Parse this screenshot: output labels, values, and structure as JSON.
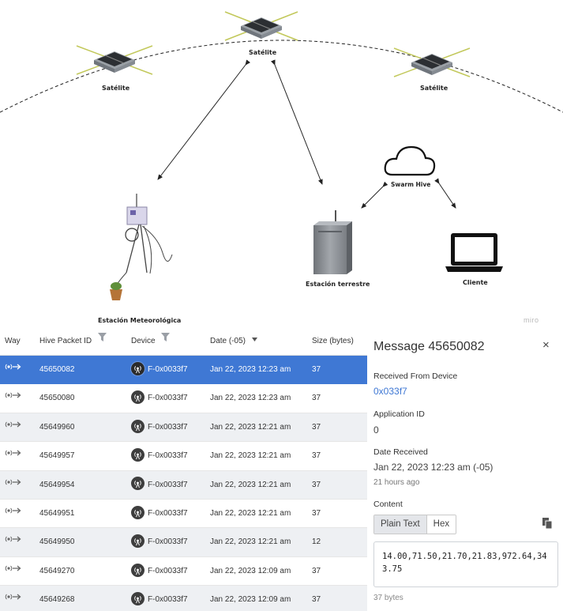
{
  "diagram": {
    "satellites": [
      "Satélite",
      "Satélite",
      "Satélite"
    ],
    "weather_station": "Estación Meteorológica",
    "ground_station": "Estación terrestre",
    "swarm_hive": "Swarm Hive",
    "client": "Cliente",
    "watermark": "miro"
  },
  "table": {
    "headers": {
      "way": "Way",
      "packet_id": "Hive Packet ID",
      "device": "Device",
      "date": "Date (-05)",
      "size": "Size (bytes)"
    },
    "rows": [
      {
        "id": "45650082",
        "device": "F-0x0033f7",
        "date": "Jan 22, 2023 12:23 am",
        "size": "37",
        "selected": true
      },
      {
        "id": "45650080",
        "device": "F-0x0033f7",
        "date": "Jan 22, 2023 12:23 am",
        "size": "37"
      },
      {
        "id": "45649960",
        "device": "F-0x0033f7",
        "date": "Jan 22, 2023 12:21 am",
        "size": "37"
      },
      {
        "id": "45649957",
        "device": "F-0x0033f7",
        "date": "Jan 22, 2023 12:21 am",
        "size": "37"
      },
      {
        "id": "45649954",
        "device": "F-0x0033f7",
        "date": "Jan 22, 2023 12:21 am",
        "size": "37"
      },
      {
        "id": "45649951",
        "device": "F-0x0033f7",
        "date": "Jan 22, 2023 12:21 am",
        "size": "37"
      },
      {
        "id": "45649950",
        "device": "F-0x0033f7",
        "date": "Jan 22, 2023 12:21 am",
        "size": "12"
      },
      {
        "id": "45649270",
        "device": "F-0x0033f7",
        "date": "Jan 22, 2023 12:09 am",
        "size": "37"
      },
      {
        "id": "45649268",
        "device": "F-0x0033f7",
        "date": "Jan 22, 2023 12:09 am",
        "size": "37"
      }
    ]
  },
  "panel": {
    "title": "Message 45650082",
    "close": "×",
    "received_from_label": "Received From Device",
    "received_from_value": "0x033f7",
    "app_id_label": "Application ID",
    "app_id_value": "0",
    "date_label": "Date Received",
    "date_value": "Jan 22, 2023 12:23 am (-05)",
    "date_relative": "21 hours ago",
    "content_label": "Content",
    "tab_plain": "Plain Text",
    "tab_hex": "Hex",
    "content_value": "14.00,71.50,21.70,21.83,972.64,343.75",
    "size_text": "37 bytes"
  },
  "colors": {
    "selected_row": "#3f78d4",
    "alt_row": "#eef0f3",
    "link": "#3f78d4"
  }
}
